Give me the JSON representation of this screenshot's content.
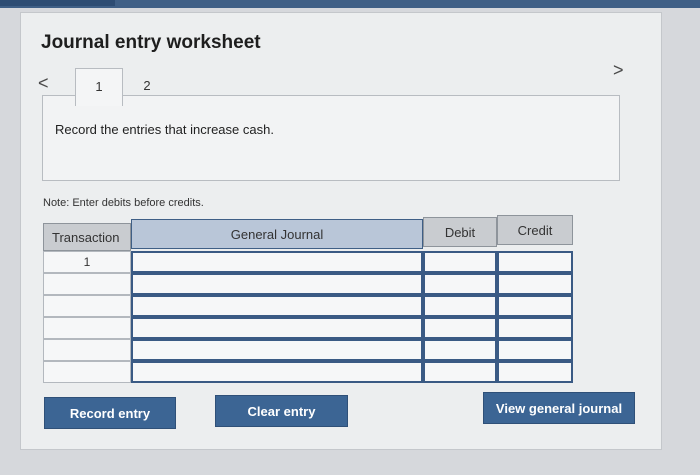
{
  "header": {
    "title": "Journal entry worksheet"
  },
  "nav": {
    "prev_icon": "chevron-left-icon",
    "next_icon": "chevron-right-icon",
    "prev_glyph": "<",
    "next_glyph": ">"
  },
  "tabs": [
    {
      "label": "1"
    },
    {
      "label": "2"
    }
  ],
  "instruction": "Record the entries that increase cash.",
  "note": "Note: Enter debits before credits.",
  "journal": {
    "columns": {
      "transaction": "Transaction",
      "account": "General Journal",
      "debit": "Debit",
      "credit": "Credit"
    },
    "rows": [
      {
        "transaction": "1",
        "account": "",
        "debit": "",
        "credit": ""
      },
      {
        "transaction": "",
        "account": "",
        "debit": "",
        "credit": ""
      },
      {
        "transaction": "",
        "account": "",
        "debit": "",
        "credit": ""
      },
      {
        "transaction": "",
        "account": "",
        "debit": "",
        "credit": ""
      },
      {
        "transaction": "",
        "account": "",
        "debit": "",
        "credit": ""
      },
      {
        "transaction": "",
        "account": "",
        "debit": "",
        "credit": ""
      }
    ]
  },
  "buttons": {
    "record": "Record entry",
    "clear": "Clear entry",
    "view": "View general journal"
  },
  "colors": {
    "primary": "#3c6594",
    "border_active": "#3a5a84"
  }
}
